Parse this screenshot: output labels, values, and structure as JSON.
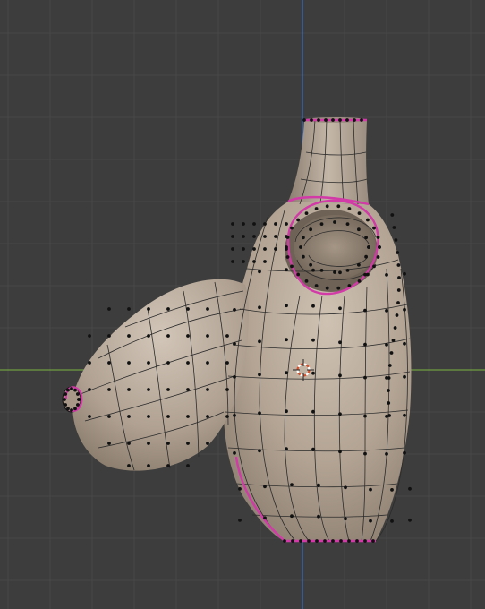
{
  "app": {
    "name": "",
    "mode": ""
  },
  "viewport": {
    "background_color": "#3d3d3d",
    "grid_color": "#484848",
    "x_axis_color": "#6fa043",
    "y_axis_color": "#3b6fc2"
  },
  "mesh": {
    "surface_color": "#b5a697",
    "wire_color": "#2b2b2b",
    "vertex_color": "#111111",
    "selected_edge_color": "#d23aa8",
    "parts": [
      "body",
      "neck",
      "opening",
      "bulb",
      "spout"
    ]
  },
  "cursor": {
    "icon": "3d-cursor-icon",
    "ring_colors": [
      "#d4512d",
      "#ffffff"
    ]
  }
}
